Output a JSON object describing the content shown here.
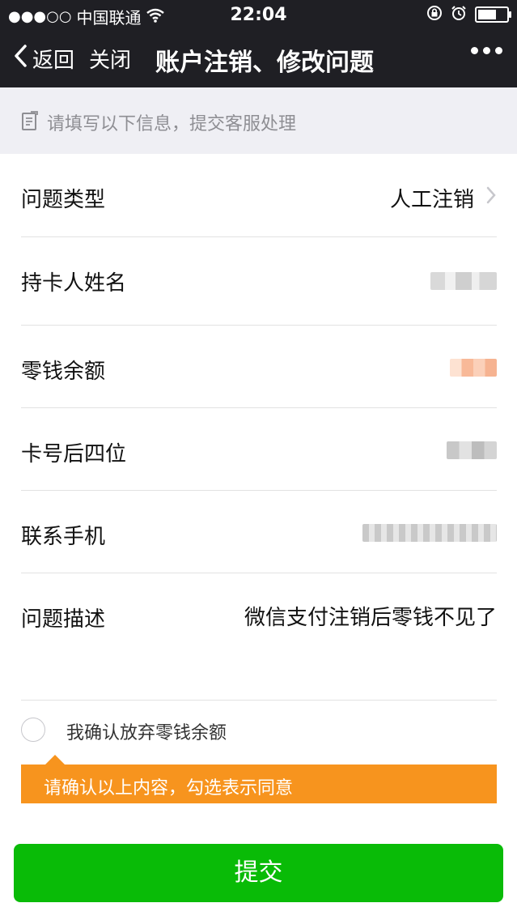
{
  "status_bar": {
    "signal": "●●●○○",
    "carrier": "中国联通",
    "time": "22:04"
  },
  "nav": {
    "back_label": "返回",
    "close_label": "关闭",
    "title": "账户注销、修改问题"
  },
  "hint": {
    "text": "请填写以下信息，提交客服处理"
  },
  "form": {
    "problem_type": {
      "label": "问题类型",
      "value": "人工注销"
    },
    "cardholder_name": {
      "label": "持卡人姓名"
    },
    "balance": {
      "label": "零钱余额"
    },
    "card_last_four": {
      "label": "卡号后四位"
    },
    "phone": {
      "label": "联系手机"
    },
    "description": {
      "label": "问题描述",
      "value": "微信支付注销后零钱不见了"
    }
  },
  "confirm": {
    "label": "我确认放弃零钱余额",
    "tooltip": "请确认以上内容，勾选表示同意"
  },
  "submit_label": "提交",
  "colors": {
    "nav_bg": "#1f1f24",
    "accent_green": "#09bb07",
    "tooltip_orange": "#f7941e",
    "hint_bg": "#efeff4"
  }
}
